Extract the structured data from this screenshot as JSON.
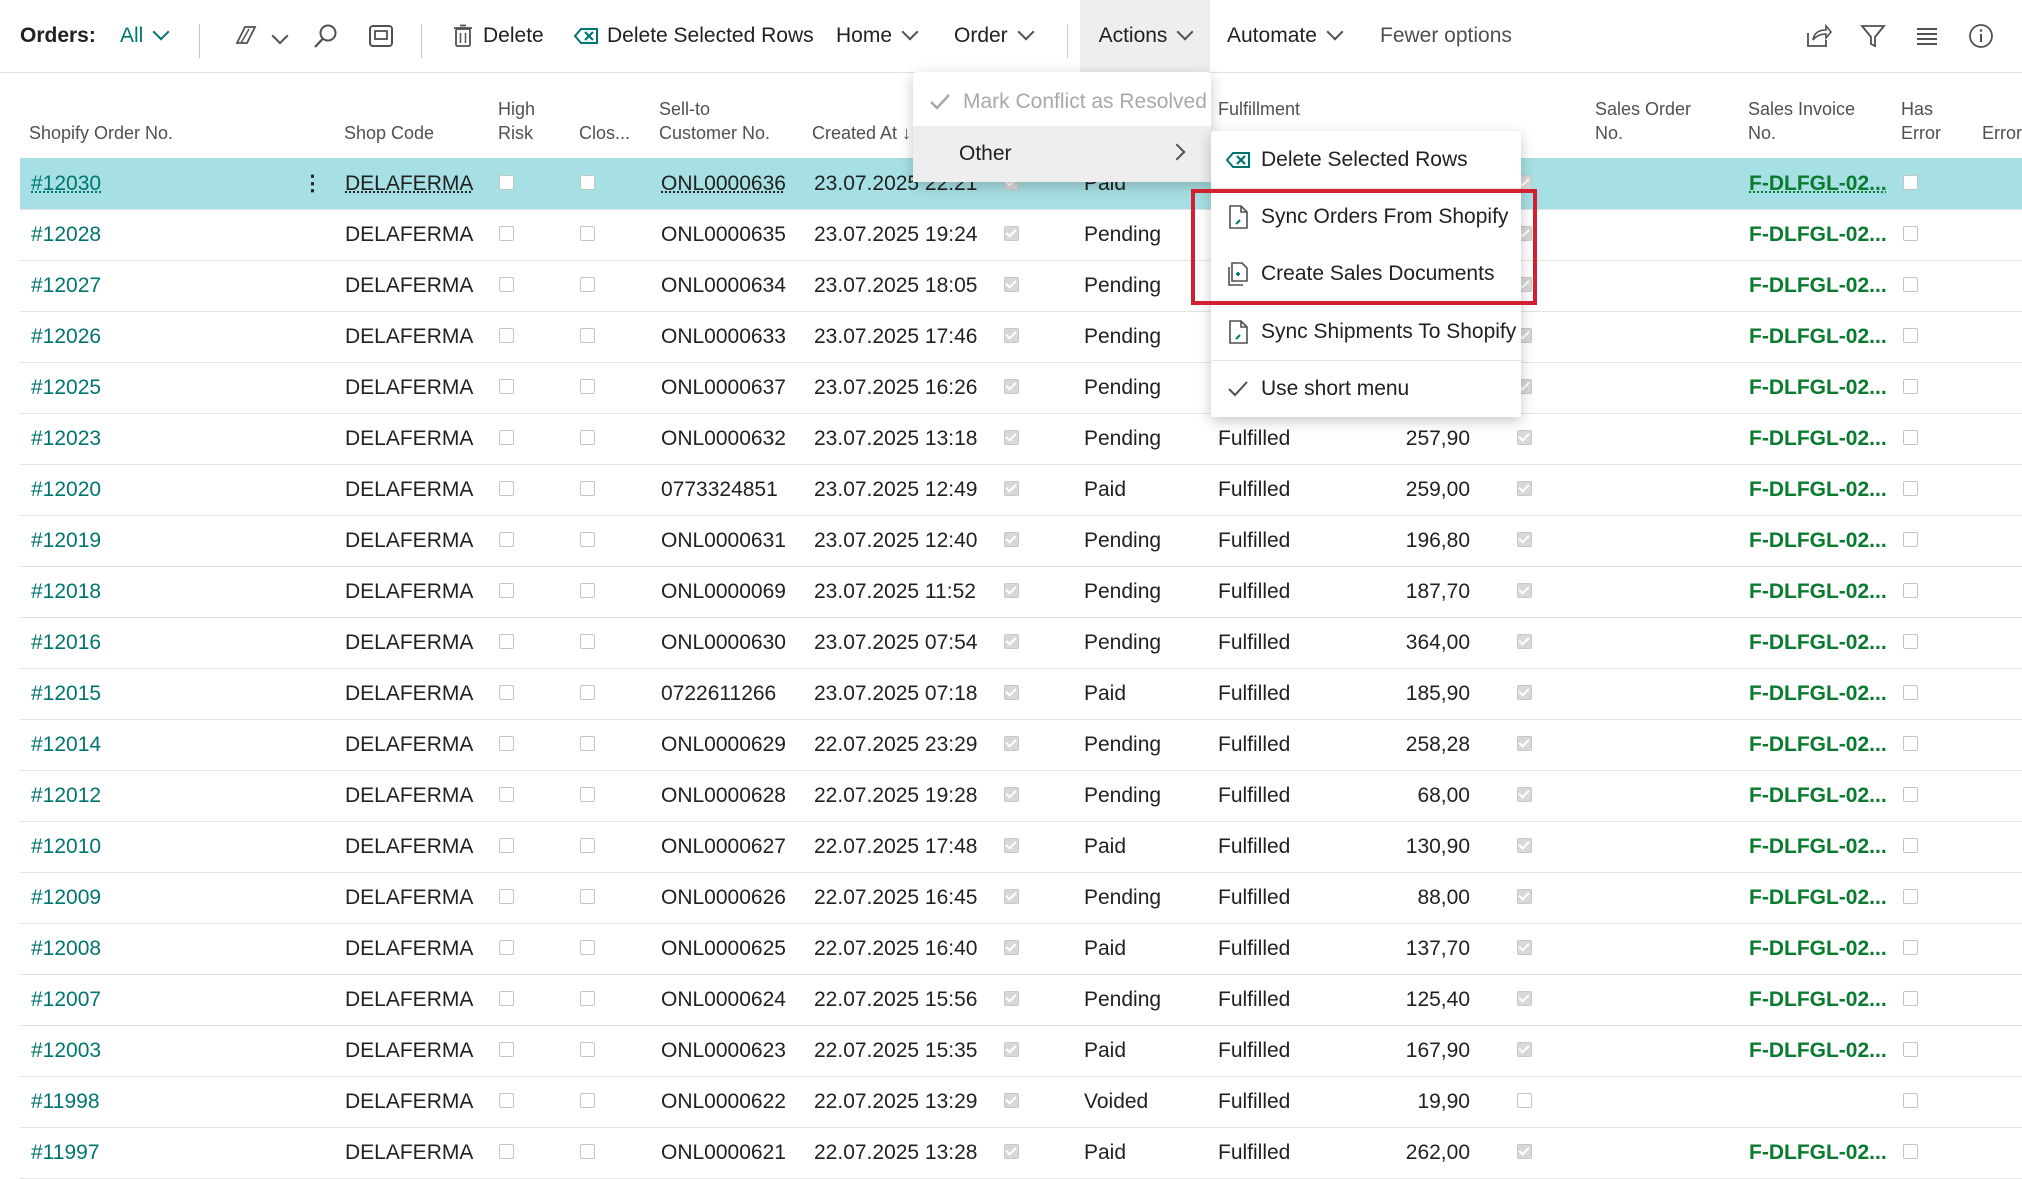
{
  "actionbar": {
    "title": "Orders:",
    "view_filter": "All",
    "delete_label": "Delete",
    "delete_selected_rows_label": "Delete Selected Rows",
    "home_label": "Home",
    "order_label": "Order",
    "actions_label": "Actions",
    "automate_label": "Automate",
    "fewer_options_label": "Fewer options"
  },
  "columns": {
    "order_no": "Shopify Order No.",
    "shop_code": "Shop Code",
    "high_risk_1": "High",
    "high_risk_2": "Risk",
    "closed": "Clos...",
    "sell_to_1": "Sell-to",
    "sell_to_2": "Customer No.",
    "created_at": "Created At ↓",
    "fulfillment_1": "Fulfillment",
    "sales_order_1": "Sales Order",
    "sales_order_2": "No.",
    "sales_invoice_1": "Sales Invoice",
    "sales_invoice_2": "No.",
    "has_error_1": "Has",
    "has_error_2": "Error",
    "error": "Error"
  },
  "rows": [
    {
      "order": "#12030",
      "shop": "DELAFERMA",
      "high_risk": false,
      "closed": false,
      "customer": "ONL0000636",
      "created": "23.07.2025 22:21",
      "processed": true,
      "financial": "Paid",
      "fulfillment": "",
      "total": "",
      "pro": true,
      "invoice": "F-DLFGL-02...",
      "has_error": false
    },
    {
      "order": "#12028",
      "shop": "DELAFERMA",
      "high_risk": false,
      "closed": false,
      "customer": "ONL0000635",
      "created": "23.07.2025 19:24",
      "processed": true,
      "financial": "Pending",
      "fulfillment": "",
      "total": "",
      "pro": true,
      "invoice": "F-DLFGL-02...",
      "has_error": false
    },
    {
      "order": "#12027",
      "shop": "DELAFERMA",
      "high_risk": false,
      "closed": false,
      "customer": "ONL0000634",
      "created": "23.07.2025 18:05",
      "processed": true,
      "financial": "Pending",
      "fulfillment": "",
      "total": "",
      "pro": true,
      "invoice": "F-DLFGL-02...",
      "has_error": false
    },
    {
      "order": "#12026",
      "shop": "DELAFERMA",
      "high_risk": false,
      "closed": false,
      "customer": "ONL0000633",
      "created": "23.07.2025 17:46",
      "processed": true,
      "financial": "Pending",
      "fulfillment": "",
      "total": "",
      "pro": true,
      "invoice": "F-DLFGL-02...",
      "has_error": false
    },
    {
      "order": "#12025",
      "shop": "DELAFERMA",
      "high_risk": false,
      "closed": false,
      "customer": "ONL0000637",
      "created": "23.07.2025 16:26",
      "processed": true,
      "financial": "Pending",
      "fulfillment": "",
      "total": "",
      "pro": true,
      "invoice": "F-DLFGL-02...",
      "has_error": false
    },
    {
      "order": "#12023",
      "shop": "DELAFERMA",
      "high_risk": false,
      "closed": false,
      "customer": "ONL0000632",
      "created": "23.07.2025 13:18",
      "processed": true,
      "financial": "Pending",
      "fulfillment": "Fulfilled",
      "total": "257,90",
      "pro": true,
      "invoice": "F-DLFGL-02...",
      "has_error": false
    },
    {
      "order": "#12020",
      "shop": "DELAFERMA",
      "high_risk": false,
      "closed": false,
      "customer": "0773324851",
      "created": "23.07.2025 12:49",
      "processed": true,
      "financial": "Paid",
      "fulfillment": "Fulfilled",
      "total": "259,00",
      "pro": true,
      "invoice": "F-DLFGL-02...",
      "has_error": false
    },
    {
      "order": "#12019",
      "shop": "DELAFERMA",
      "high_risk": false,
      "closed": false,
      "customer": "ONL0000631",
      "created": "23.07.2025 12:40",
      "processed": true,
      "financial": "Pending",
      "fulfillment": "Fulfilled",
      "total": "196,80",
      "pro": true,
      "invoice": "F-DLFGL-02...",
      "has_error": false
    },
    {
      "order": "#12018",
      "shop": "DELAFERMA",
      "high_risk": false,
      "closed": false,
      "customer": "ONL0000069",
      "created": "23.07.2025 11:52",
      "processed": true,
      "financial": "Pending",
      "fulfillment": "Fulfilled",
      "total": "187,70",
      "pro": true,
      "invoice": "F-DLFGL-02...",
      "has_error": false
    },
    {
      "order": "#12016",
      "shop": "DELAFERMA",
      "high_risk": false,
      "closed": false,
      "customer": "ONL0000630",
      "created": "23.07.2025 07:54",
      "processed": true,
      "financial": "Pending",
      "fulfillment": "Fulfilled",
      "total": "364,00",
      "pro": true,
      "invoice": "F-DLFGL-02...",
      "has_error": false
    },
    {
      "order": "#12015",
      "shop": "DELAFERMA",
      "high_risk": false,
      "closed": false,
      "customer": "0722611266",
      "created": "23.07.2025 07:18",
      "processed": true,
      "financial": "Paid",
      "fulfillment": "Fulfilled",
      "total": "185,90",
      "pro": true,
      "invoice": "F-DLFGL-02...",
      "has_error": false
    },
    {
      "order": "#12014",
      "shop": "DELAFERMA",
      "high_risk": false,
      "closed": false,
      "customer": "ONL0000629",
      "created": "22.07.2025 23:29",
      "processed": true,
      "financial": "Pending",
      "fulfillment": "Fulfilled",
      "total": "258,28",
      "pro": true,
      "invoice": "F-DLFGL-02...",
      "has_error": false
    },
    {
      "order": "#12012",
      "shop": "DELAFERMA",
      "high_risk": false,
      "closed": false,
      "customer": "ONL0000628",
      "created": "22.07.2025 19:28",
      "processed": true,
      "financial": "Pending",
      "fulfillment": "Fulfilled",
      "total": "68,00",
      "pro": true,
      "invoice": "F-DLFGL-02...",
      "has_error": false
    },
    {
      "order": "#12010",
      "shop": "DELAFERMA",
      "high_risk": false,
      "closed": false,
      "customer": "ONL0000627",
      "created": "22.07.2025 17:48",
      "processed": true,
      "financial": "Paid",
      "fulfillment": "Fulfilled",
      "total": "130,90",
      "pro": true,
      "invoice": "F-DLFGL-02...",
      "has_error": false
    },
    {
      "order": "#12009",
      "shop": "DELAFERMA",
      "high_risk": false,
      "closed": false,
      "customer": "ONL0000626",
      "created": "22.07.2025 16:45",
      "processed": true,
      "financial": "Pending",
      "fulfillment": "Fulfilled",
      "total": "88,00",
      "pro": true,
      "invoice": "F-DLFGL-02...",
      "has_error": false
    },
    {
      "order": "#12008",
      "shop": "DELAFERMA",
      "high_risk": false,
      "closed": false,
      "customer": "ONL0000625",
      "created": "22.07.2025 16:40",
      "processed": true,
      "financial": "Paid",
      "fulfillment": "Fulfilled",
      "total": "137,70",
      "pro": true,
      "invoice": "F-DLFGL-02...",
      "has_error": false
    },
    {
      "order": "#12007",
      "shop": "DELAFERMA",
      "high_risk": false,
      "closed": false,
      "customer": "ONL0000624",
      "created": "22.07.2025 15:56",
      "processed": true,
      "financial": "Pending",
      "fulfillment": "Fulfilled",
      "total": "125,40",
      "pro": true,
      "invoice": "F-DLFGL-02...",
      "has_error": false
    },
    {
      "order": "#12003",
      "shop": "DELAFERMA",
      "high_risk": false,
      "closed": false,
      "customer": "ONL0000623",
      "created": "22.07.2025 15:35",
      "processed": true,
      "financial": "Paid",
      "fulfillment": "Fulfilled",
      "total": "167,90",
      "pro": true,
      "invoice": "F-DLFGL-02...",
      "has_error": false
    },
    {
      "order": "#11998",
      "shop": "DELAFERMA",
      "high_risk": false,
      "closed": false,
      "customer": "ONL0000622",
      "created": "22.07.2025 13:29",
      "processed": true,
      "financial": "Voided",
      "fulfillment": "Fulfilled",
      "total": "19,90",
      "pro": false,
      "invoice": "",
      "has_error": false
    },
    {
      "order": "#11997",
      "shop": "DELAFERMA",
      "high_risk": false,
      "closed": false,
      "customer": "ONL0000621",
      "created": "22.07.2025 13:28",
      "processed": true,
      "financial": "Paid",
      "fulfillment": "Fulfilled",
      "total": "262,00",
      "pro": true,
      "invoice": "F-DLFGL-02...",
      "has_error": false
    }
  ],
  "actions_menu": {
    "mark_conflict_label": "Mark Conflict as Resolved",
    "other_label": "Other"
  },
  "other_submenu": {
    "items": [
      {
        "label": "Delete Selected Rows",
        "icon": "delete-rows-icon"
      },
      {
        "label": "Sync Orders From Shopify",
        "icon": "document-icon"
      },
      {
        "label": "Create Sales Documents",
        "icon": "create-document-icon"
      },
      {
        "label": "Sync Shipments To Shopify",
        "icon": "document-icon"
      },
      {
        "label": "Use short menu",
        "icon": "checkmark-icon"
      }
    ]
  },
  "colors": {
    "accent_teal": "#00756f",
    "selected_row": "#a6e0e4",
    "invoice_green": "#0a7a2e",
    "highlight_red": "#d32030"
  }
}
